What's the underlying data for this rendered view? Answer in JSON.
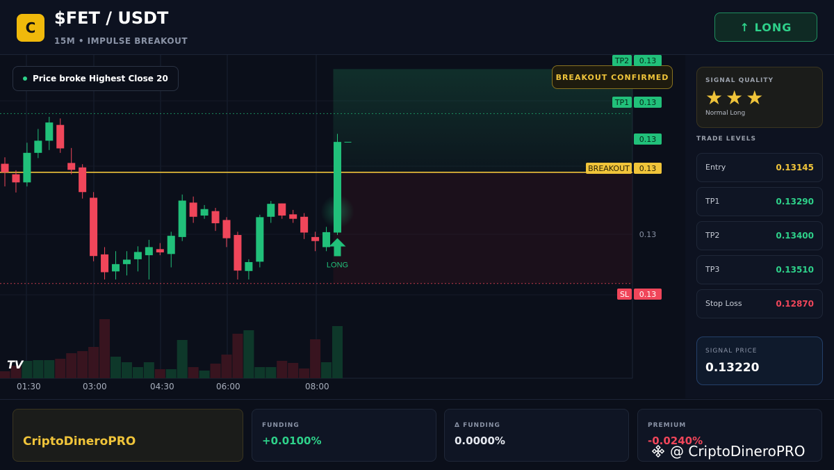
{
  "header": {
    "logo_letter": "C",
    "pair": "$FET / USDT",
    "subtitle": "15M • IMPULSE BREAKOUT",
    "direction_button": "↑ LONG"
  },
  "chart": {
    "note": "Price broke Highest Close 20",
    "status_badge": "BREAKOUT CONFIRMED",
    "tradingview_logo": "TV",
    "signal_marker": "LONG",
    "price_tags": {
      "tp2_label": "TP2",
      "tp2_value": "0.13",
      "tp1_label": "TP1",
      "tp1_value": "0.13",
      "last_value": "0.13",
      "breakout_label": "BREAKOUT",
      "breakout_value": "0.13",
      "axis_value": "0.13",
      "sl_label": "SL",
      "sl_value": "0.13"
    },
    "x_ticks": [
      "01:30",
      "03:00",
      "04:30",
      "06:00",
      "08:00"
    ]
  },
  "chart_data": {
    "type": "candlestick",
    "interval": "15m",
    "candles": [
      {
        "o": 0.13166,
        "h": 0.13182,
        "l": 0.1311,
        "c": 0.13145
      },
      {
        "o": 0.1314,
        "h": 0.1315,
        "l": 0.13095,
        "c": 0.1312
      },
      {
        "o": 0.1312,
        "h": 0.13218,
        "l": 0.1311,
        "c": 0.13193
      },
      {
        "o": 0.13193,
        "h": 0.13252,
        "l": 0.1318,
        "c": 0.13223
      },
      {
        "o": 0.13223,
        "h": 0.13282,
        "l": 0.132,
        "c": 0.13268
      },
      {
        "o": 0.13262,
        "h": 0.13278,
        "l": 0.13193,
        "c": 0.13204
      },
      {
        "o": 0.13168,
        "h": 0.13205,
        "l": 0.1314,
        "c": 0.13151
      },
      {
        "o": 0.13157,
        "h": 0.13165,
        "l": 0.1308,
        "c": 0.13096
      },
      {
        "o": 0.13082,
        "h": 0.13096,
        "l": 0.12925,
        "c": 0.12938
      },
      {
        "o": 0.12942,
        "h": 0.1296,
        "l": 0.1288,
        "c": 0.12898
      },
      {
        "o": 0.129,
        "h": 0.1295,
        "l": 0.1288,
        "c": 0.12918
      },
      {
        "o": 0.12918,
        "h": 0.1295,
        "l": 0.1289,
        "c": 0.12929
      },
      {
        "o": 0.1293,
        "h": 0.12962,
        "l": 0.129,
        "c": 0.12948
      },
      {
        "o": 0.1294,
        "h": 0.12978,
        "l": 0.1288,
        "c": 0.1296
      },
      {
        "o": 0.12955,
        "h": 0.1297,
        "l": 0.1294,
        "c": 0.12947
      },
      {
        "o": 0.12943,
        "h": 0.12998,
        "l": 0.1291,
        "c": 0.12988
      },
      {
        "o": 0.12985,
        "h": 0.1309,
        "l": 0.12975,
        "c": 0.13075
      },
      {
        "o": 0.1307,
        "h": 0.13085,
        "l": 0.1302,
        "c": 0.13035
      },
      {
        "o": 0.13038,
        "h": 0.13064,
        "l": 0.1303,
        "c": 0.13054
      },
      {
        "o": 0.13049,
        "h": 0.13057,
        "l": 0.13,
        "c": 0.13019
      },
      {
        "o": 0.13027,
        "h": 0.13034,
        "l": 0.1296,
        "c": 0.12982
      },
      {
        "o": 0.1299,
        "h": 0.12998,
        "l": 0.1288,
        "c": 0.12902
      },
      {
        "o": 0.12901,
        "h": 0.1293,
        "l": 0.1288,
        "c": 0.12923
      },
      {
        "o": 0.12924,
        "h": 0.1304,
        "l": 0.1291,
        "c": 0.13034
      },
      {
        "o": 0.13035,
        "h": 0.13074,
        "l": 0.1302,
        "c": 0.13067
      },
      {
        "o": 0.13068,
        "h": 0.13068,
        "l": 0.1303,
        "c": 0.13038
      },
      {
        "o": 0.13041,
        "h": 0.13052,
        "l": 0.1302,
        "c": 0.1303
      },
      {
        "o": 0.13035,
        "h": 0.13044,
        "l": 0.1298,
        "c": 0.12996
      },
      {
        "o": 0.12985,
        "h": 0.12998,
        "l": 0.1295,
        "c": 0.12975
      },
      {
        "o": 0.1296,
        "h": 0.1301,
        "l": 0.1295,
        "c": 0.12997
      },
      {
        "o": 0.12996,
        "h": 0.1324,
        "l": 0.1299,
        "c": 0.1322
      }
    ],
    "volumes": [
      1.0,
      1.8,
      2.5,
      2.6,
      2.6,
      2.8,
      3.6,
      3.9,
      4.5,
      8.5,
      3.1,
      2.3,
      1.6,
      2.3,
      1.3,
      1.3,
      5.5,
      1.6,
      1.1,
      2.1,
      3.4,
      6.4,
      6.9,
      1.6,
      1.6,
      2.5,
      2.2,
      1.4,
      5.6,
      2.3,
      7.5
    ],
    "horizontal_levels": {
      "tp2": 0.134,
      "tp1": 0.1329,
      "breakout": 0.13145,
      "stop_loss": 0.1287
    },
    "signal": {
      "candle_index": 30,
      "label": "LONG",
      "price": 0.1322
    }
  },
  "sidebar": {
    "quality_title": "SIGNAL QUALITY",
    "stars": "★★★",
    "star_rating": 3,
    "quality_label": "Normal Long",
    "levels_title": "TRADE LEVELS",
    "levels": [
      {
        "label": "Entry",
        "value": "0.13145",
        "color": "#f0c43a"
      },
      {
        "label": "TP1",
        "value": "0.13290",
        "color": "#2ed18a"
      },
      {
        "label": "TP2",
        "value": "0.13400",
        "color": "#2ed18a"
      },
      {
        "label": "TP3",
        "value": "0.13510",
        "color": "#2ed18a"
      },
      {
        "label": "Stop Loss",
        "value": "0.12870",
        "color": "#f0465a"
      }
    ],
    "signal_price_label": "SIGNAL PRICE",
    "signal_price": "0.13220"
  },
  "footer": {
    "brand": "CriptoDineroPRO",
    "stats": [
      {
        "label": "FUNDING",
        "value": "+0.0100%",
        "color": "#2ed18a"
      },
      {
        "label": "Δ FUNDING",
        "value": "0.0000%",
        "color": "#e6e9f0"
      },
      {
        "label": "PREMIUM",
        "value": "-0.0240%",
        "color": "#f0465a"
      }
    ],
    "watermark": "@ CriptoDineroPRO"
  },
  "colors": {
    "up": "#21c07a",
    "down": "#f0465a",
    "breakout": "#f0c43a",
    "background": "#0b0f1a"
  }
}
